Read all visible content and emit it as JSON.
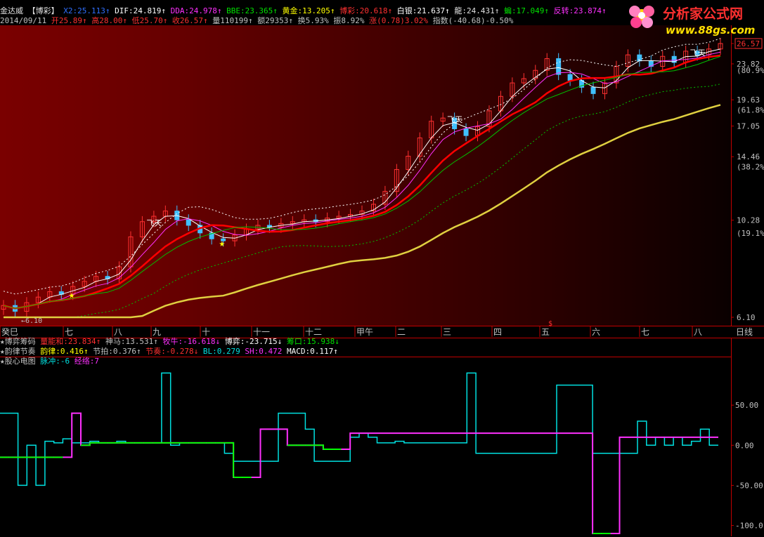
{
  "header1": [
    {
      "text": "金达威",
      "color": "#e0e0e0"
    },
    {
      "text": "  【博彩】",
      "color": "#e0e0e0"
    },
    {
      "text": " X2:25.113↑",
      "color": "#3070ff"
    },
    {
      "text": " DIF:24.819↑",
      "color": "#ffffff"
    },
    {
      "text": " DDA:24.978↑",
      "color": "#ff30ff"
    },
    {
      "text": " BBE:23.365↑",
      "color": "#00e000"
    },
    {
      "text": " 黄金:13.205↑",
      "color": "#ffff00"
    },
    {
      "text": " 博彩:20.618↑",
      "color": "#ff3030"
    },
    {
      "text": " 白银:21.637↑",
      "color": "#ffffff"
    },
    {
      "text": " 龍:24.431↑",
      "color": "#e0e0e0"
    },
    {
      "text": " 蝙:17.049↑",
      "color": "#00e000"
    },
    {
      "text": " 反转:23.874↑",
      "color": "#ff30ff"
    }
  ],
  "header2": [
    {
      "text": "2014/09/11",
      "color": "#c0c0c0"
    },
    {
      "text": " 开25.89↑",
      "color": "#ff3030"
    },
    {
      "text": " 高28.00↑",
      "color": "#ff3030"
    },
    {
      "text": " 低25.70↑",
      "color": "#ff3030"
    },
    {
      "text": " 收26.57↑",
      "color": "#ff3030"
    },
    {
      "text": " 量110199↑",
      "color": "#c0c0c0"
    },
    {
      "text": " 额29353↑",
      "color": "#c0c0c0"
    },
    {
      "text": " 换5.93%",
      "color": "#c0c0c0"
    },
    {
      "text": " 振8.92%",
      "color": "#c0c0c0"
    },
    {
      "text": " 涨(0.78)3.02%",
      "color": "#ff3030"
    },
    {
      "text": " 指数(-40.68)-0.50%",
      "color": "#c0c0c0"
    }
  ],
  "logo": {
    "title": "分析家公式网",
    "url": "www.88gs.com"
  },
  "price_axis": [
    {
      "label": "26.57",
      "boxed": true,
      "value": 26.57
    },
    {
      "label": "23.82",
      "value": 23.82
    },
    {
      "label": "(80.9%)",
      "value": 23.0,
      "pct": true
    },
    {
      "label": "19.63",
      "value": 19.63
    },
    {
      "label": "(61.8%)",
      "value": 18.6,
      "pct": true
    },
    {
      "label": "17.05",
      "value": 17.05
    },
    {
      "label": "14.46",
      "value": 14.46
    },
    {
      "label": "(38.2%)",
      "value": 13.7,
      "pct": true
    },
    {
      "label": "10.28",
      "value": 10.28
    },
    {
      "label": "(19.1%)",
      "value": 9.6,
      "pct": true
    },
    {
      "label": "6.10",
      "value": 6.1
    }
  ],
  "x_axis": {
    "months": [
      "癸巳",
      "七",
      "八",
      "九",
      "十",
      "十一",
      "十二",
      "甲午",
      "二",
      "三",
      "四",
      "五",
      "六",
      "七",
      "八"
    ],
    "period_label": "日线",
    "marker": "$",
    "low_label": "6.10"
  },
  "annotations": [
    "飞天",
    "飞天",
    "飞天"
  ],
  "indicator_rows": [
    [
      {
        "text": "★博弈筹码",
        "color": "#c0c0c0"
      },
      {
        "text": " 量能和:23.834↑",
        "color": "#ff3030"
      },
      {
        "text": " 神马:13.531↑",
        "color": "#c0c0c0"
      },
      {
        "text": " 牧牛:-16.618↓",
        "color": "#ff30ff"
      },
      {
        "text": " 博弈:-23.715↓",
        "color": "#ffffff"
      },
      {
        "text": " 筹口:15.938↓",
        "color": "#00e000"
      }
    ],
    [
      {
        "text": "★韵律节奏",
        "color": "#c0c0c0"
      },
      {
        "text": " 韵律:0.416↑",
        "color": "#ffff00"
      },
      {
        "text": " 节拍:0.376↑",
        "color": "#c0c0c0"
      },
      {
        "text": " 节奏:-0.278↓",
        "color": "#ff3030"
      },
      {
        "text": " BL:0.279",
        "color": "#00e0e0"
      },
      {
        "text": " SH:0.472",
        "color": "#ff30ff"
      },
      {
        "text": " MACD:0.117↑",
        "color": "#ffffff"
      }
    ],
    [
      {
        "text": "★股心电图",
        "color": "#c0c0c0"
      },
      {
        "text": " 脉冲:-6",
        "color": "#00e0e0"
      },
      {
        "text": " 经络:7",
        "color": "#ff30ff"
      }
    ]
  ],
  "sub_axis": [
    "50.00",
    "0.00",
    "-50.00",
    "-100.0"
  ],
  "colors": {
    "bg": "#000000",
    "up": "#ff3030",
    "down": "#40c0ff",
    "border": "#c00000"
  },
  "chart_data": [
    {
      "type": "candlestick",
      "ylim": [
        6.1,
        26.57
      ],
      "y_scale": "log",
      "close": [
        6.5,
        6.3,
        6.6,
        6.8,
        7.0,
        6.9,
        7.2,
        7.4,
        7.6,
        7.5,
        8.0,
        9.4,
        10.2,
        10.5,
        10.8,
        10.3,
        10.0,
        9.6,
        9.3,
        9.2,
        9.5,
        9.8,
        10.0,
        9.9,
        10.1,
        10.2,
        10.3,
        10.2,
        10.4,
        10.5,
        10.6,
        10.8,
        11.2,
        12.0,
        13.5,
        14.5,
        16.0,
        17.5,
        17.8,
        16.8,
        16.2,
        17.0,
        18.5,
        20.0,
        21.5,
        22.0,
        23.0,
        24.5,
        22.5,
        21.8,
        21.0,
        20.3,
        21.5,
        23.5,
        25.0,
        24.2,
        23.5,
        24.8,
        24.0,
        25.5,
        25.0,
        25.8,
        26.57
      ],
      "legend": [
        "X2",
        "DIF",
        "DDA",
        "BBE",
        "黄金",
        "博彩",
        "白银",
        "龍",
        "蝙",
        "反转"
      ]
    },
    {
      "type": "line",
      "ylim": [
        -110,
        100
      ],
      "series": [
        {
          "name": "脉冲",
          "color": "#00e0e0",
          "values": [
            40,
            40,
            -50,
            0,
            -50,
            5,
            3,
            8,
            3,
            3,
            5,
            3,
            3,
            5,
            3,
            3,
            3,
            3,
            90,
            0,
            3,
            3,
            3,
            3,
            3,
            -10,
            -20,
            -20,
            -20,
            -20,
            -20,
            40,
            40,
            40,
            20,
            -20,
            -20,
            -20,
            -20,
            10,
            15,
            10,
            3,
            3,
            5,
            3,
            3,
            3,
            3,
            3,
            3,
            3,
            90,
            -10,
            -10,
            -10,
            -10,
            -10,
            -10,
            -10,
            -10,
            -10,
            75,
            75,
            75,
            75,
            -10,
            -10,
            -10,
            -10,
            -10,
            30,
            0,
            10,
            0,
            10,
            0,
            5,
            20,
            0,
            0
          ]
        },
        {
          "name": "经络",
          "color": "#ff30ff",
          "values": [
            -15,
            -15,
            -15,
            -15,
            -15,
            -15,
            -15,
            -15,
            40,
            0,
            3,
            3,
            3,
            3,
            3,
            3,
            3,
            3,
            3,
            3,
            3,
            3,
            3,
            3,
            3,
            3,
            -40,
            -40,
            -40,
            20,
            20,
            20,
            0,
            0,
            0,
            0,
            -5,
            -5,
            -5,
            15,
            15,
            15,
            15,
            15,
            15,
            15,
            15,
            15,
            15,
            15,
            15,
            15,
            15,
            15,
            15,
            15,
            15,
            15,
            15,
            15,
            15,
            15,
            15,
            15,
            15,
            15,
            -110,
            -110,
            -110,
            10,
            10,
            10,
            10,
            10,
            10,
            10,
            10,
            10,
            10,
            10,
            10
          ]
        }
      ]
    }
  ]
}
